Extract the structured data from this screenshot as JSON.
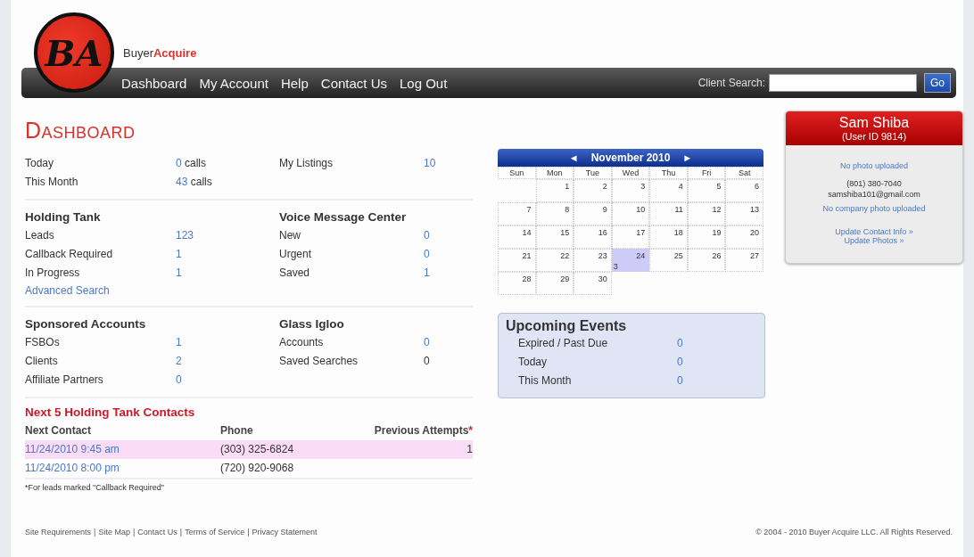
{
  "logo": {
    "letters": "BA",
    "brand_first": "Buyer",
    "brand_second": "Acquire"
  },
  "nav": {
    "links": [
      "Dashboard",
      "My Account",
      "Help",
      "Contact Us",
      "Log Out"
    ],
    "search_label": "Client Search:",
    "search_button": "Go"
  },
  "page_title": "DASHBOARD",
  "summary": {
    "left": [
      {
        "label": "Today",
        "value": "0",
        "unit": "calls"
      },
      {
        "label": "This Month",
        "value": "43",
        "unit": "calls"
      }
    ],
    "right": [
      {
        "label": "My Listings",
        "value": "10",
        "link": true
      }
    ]
  },
  "sections": [
    {
      "left": {
        "title": "Holding Tank",
        "rows": [
          {
            "label": "Leads",
            "value": "123",
            "link": true
          },
          {
            "label": "Callback Required",
            "value": "1",
            "link": true
          },
          {
            "label": "In Progress",
            "value": "1",
            "link": true
          }
        ],
        "link": "Advanced Search"
      },
      "right": {
        "title": "Voice Message Center",
        "rows": [
          {
            "label": "New",
            "value": "0",
            "link": true
          },
          {
            "label": "Urgent",
            "value": "0",
            "link": true
          },
          {
            "label": "Saved",
            "value": "1",
            "link": true
          }
        ]
      }
    },
    {
      "left": {
        "title": "Sponsored Accounts",
        "rows": [
          {
            "label": "FSBOs",
            "value": "1",
            "link": true
          },
          {
            "label": "Clients",
            "value": "2",
            "link": true
          },
          {
            "label": "Affiliate Partners",
            "value": "0",
            "link": true
          }
        ]
      },
      "right": {
        "title": "Glass Igloo",
        "rows": [
          {
            "label": "Accounts",
            "value": "0",
            "link": true
          },
          {
            "label": "Saved Searches",
            "value": "0",
            "link": false
          }
        ]
      }
    }
  ],
  "contacts": {
    "title": "Next 5 Holding Tank Contacts",
    "columns": [
      {
        "label": "Next Contact"
      },
      {
        "label": "Phone"
      },
      {
        "label": "Previous Attempts",
        "note": "*"
      }
    ],
    "rows": [
      {
        "next_contact": "11/24/2010 9:45 am",
        "phone": "(303) 325-6824",
        "attempts": "1",
        "selected": true
      },
      {
        "next_contact": "11/24/2010 8:00 pm",
        "phone": "(720) 920-9068",
        "selected": false
      }
    ],
    "footnote": "*For leads marked \"Callback Required\""
  },
  "calendar": {
    "prev": "◄",
    "month": "November 2010",
    "next": "►",
    "weekdays": [
      "Sun",
      "Mon",
      "Tue",
      "Wed",
      "Thu",
      "Fri",
      "Sat"
    ],
    "weeks": [
      [
        {
          "kind": "blank"
        },
        {
          "day": "1",
          "selected": false
        },
        {
          "day": "2",
          "selected": false
        },
        {
          "day": "3",
          "selected": false
        },
        {
          "day": "4",
          "selected": false
        },
        {
          "day": "5",
          "selected": false
        },
        {
          "day": "6",
          "selected": false
        }
      ],
      [
        {
          "day": "7",
          "selected": false
        },
        {
          "day": "8",
          "selected": false
        },
        {
          "day": "9",
          "selected": false
        },
        {
          "day": "10",
          "selected": false
        },
        {
          "day": "11",
          "selected": false
        },
        {
          "day": "12",
          "selected": false
        },
        {
          "day": "13",
          "selected": false
        }
      ],
      [
        {
          "day": "14",
          "selected": false
        },
        {
          "day": "15",
          "selected": false
        },
        {
          "day": "16",
          "selected": false
        },
        {
          "day": "17",
          "selected": false
        },
        {
          "day": "18",
          "selected": false
        },
        {
          "day": "19",
          "selected": false
        },
        {
          "day": "20",
          "selected": false
        }
      ],
      [
        {
          "day": "21",
          "selected": false
        },
        {
          "day": "22",
          "selected": false
        },
        {
          "day": "23",
          "selected": false
        },
        {
          "day": "24",
          "selected": true,
          "events": "3"
        },
        {
          "day": "25",
          "selected": false
        },
        {
          "day": "26",
          "selected": false
        },
        {
          "day": "27",
          "selected": false
        }
      ],
      [
        {
          "day": "28",
          "selected": false
        },
        {
          "day": "29",
          "selected": false
        },
        {
          "day": "30",
          "selected": false
        },
        {
          "kind": "blank"
        },
        {
          "kind": "blank"
        },
        {
          "kind": "blank"
        },
        {
          "kind": "blank"
        }
      ]
    ]
  },
  "upcoming_events": {
    "title": "Upcoming Events",
    "rows": [
      {
        "label": "Expired / Past Due",
        "value": "0"
      },
      {
        "label": "Today",
        "value": "0"
      },
      {
        "label": "This Month",
        "value": "0"
      }
    ]
  },
  "profile": {
    "name": "Sam Shiba",
    "user_id": "(User ID 9814)",
    "photo_note": "No photo uploaded",
    "phone": "(801) 380-7040",
    "email": "samshiba101@gmail.com",
    "company_photo_note": "No company photo uploaded",
    "links": [
      "Update Contact Info »",
      "Update Photos »"
    ]
  },
  "footer": {
    "links": [
      "Site Requirements",
      "Site Map",
      "Contact Us",
      "Terms of Service",
      "Privacy Statement"
    ],
    "separator": "|",
    "copyright": "© 2004 - 2010 Buyer Acquire LLC. All Rights Reserved."
  }
}
